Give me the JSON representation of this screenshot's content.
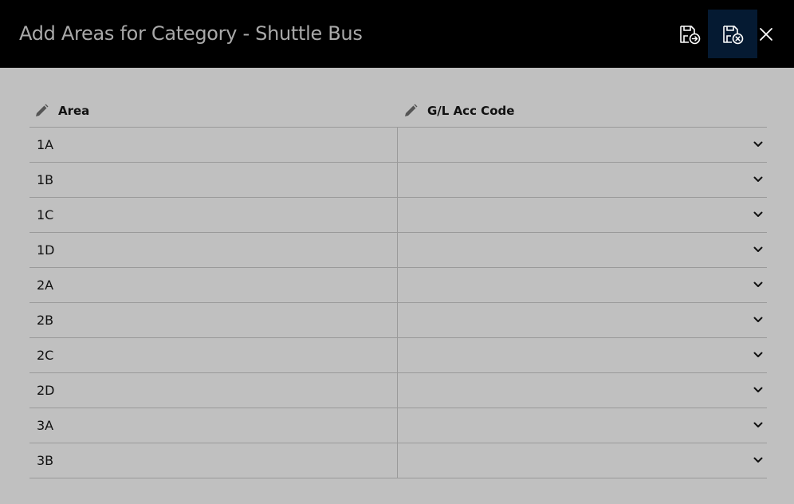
{
  "dialog": {
    "title": "Add Areas for Category - Shuttle Bus"
  },
  "toolbar": {
    "buttons": [
      {
        "name": "save-and-continue",
        "icon": "save-arrow-icon"
      },
      {
        "name": "save-and-close",
        "icon": "save-close-icon"
      },
      {
        "name": "close",
        "icon": "close-icon"
      }
    ]
  },
  "table": {
    "columns": [
      {
        "label": "Area",
        "icon": "pencil-icon"
      },
      {
        "label": "G/L Acc Code",
        "icon": "pencil-icon"
      }
    ],
    "rows": [
      {
        "area": "1A",
        "gl_code": ""
      },
      {
        "area": "1B",
        "gl_code": ""
      },
      {
        "area": "1C",
        "gl_code": ""
      },
      {
        "area": "1D",
        "gl_code": ""
      },
      {
        "area": "2A",
        "gl_code": ""
      },
      {
        "area": "2B",
        "gl_code": ""
      },
      {
        "area": "2C",
        "gl_code": ""
      },
      {
        "area": "2D",
        "gl_code": ""
      },
      {
        "area": "3A",
        "gl_code": ""
      },
      {
        "area": "3B",
        "gl_code": ""
      }
    ]
  },
  "colors": {
    "header_bg": "#000000",
    "title_text": "#a9a9a9",
    "active_button_bg": "#051a32",
    "body_bg": "#c0c0c0",
    "grid_line": "#9a9a9a"
  }
}
